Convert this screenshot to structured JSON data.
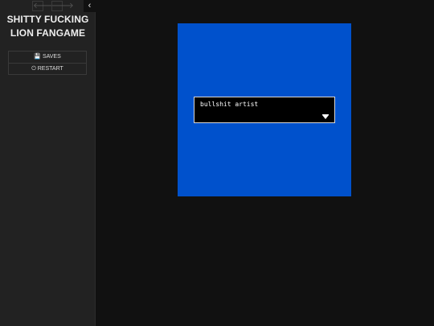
{
  "sidebar": {
    "title": "SHITTY FUCKING LION FANGAME",
    "nav_back_icon": "🡐",
    "nav_forward_icon": "🡒",
    "stow_icon": "‹",
    "menu": {
      "saves_icon": "💾",
      "saves_label": "SAVES",
      "restart_icon": "⏻",
      "restart_label": "RESTART"
    }
  },
  "game": {
    "background_color": "#0051cc",
    "dialogue_text": "bullshit artist"
  }
}
